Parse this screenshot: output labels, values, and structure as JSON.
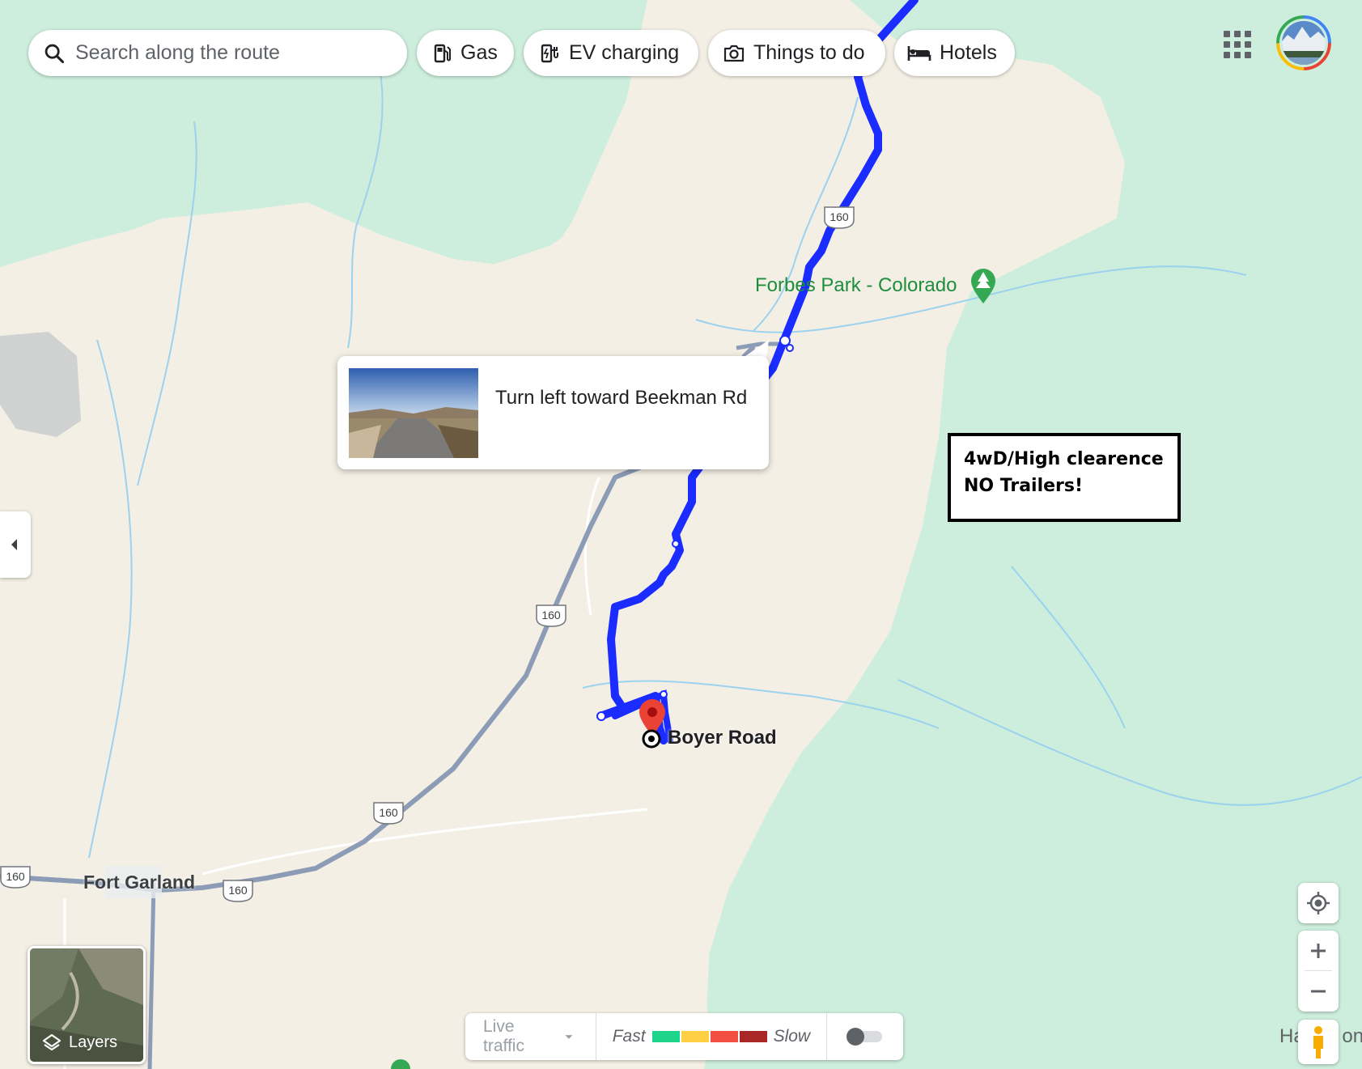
{
  "search": {
    "placeholder": "Search along the route"
  },
  "chips": [
    {
      "label": "Gas",
      "icon": "gas-pump-icon"
    },
    {
      "label": "EV charging",
      "icon": "ev-charger-icon"
    },
    {
      "label": "Things to do",
      "icon": "camera-icon"
    },
    {
      "label": "Hotels",
      "icon": "bed-icon"
    }
  ],
  "map": {
    "places": {
      "forbes_park": "Forbes Park - Colorado",
      "fort_garland": "Fort Garland",
      "boyer_road": "Boyer Road",
      "edge_town": "Ha       on"
    },
    "highway_number": "160"
  },
  "step_popup": {
    "text": "Turn left toward Beekman Rd"
  },
  "annotation": {
    "text": "4wD/High clearence\nNO Trailers!"
  },
  "layers": {
    "label": "Layers"
  },
  "traffic": {
    "live_label": "Live traffic",
    "fast_label": "Fast",
    "slow_label": "Slow",
    "colors": [
      "#1ed38a",
      "#ffcf44",
      "#f24e42",
      "#a92727"
    ]
  },
  "colors": {
    "route": "#0b1ef5",
    "forest": "#cfeee0",
    "land": "#f4efe5",
    "water": "#8fd0f0"
  }
}
